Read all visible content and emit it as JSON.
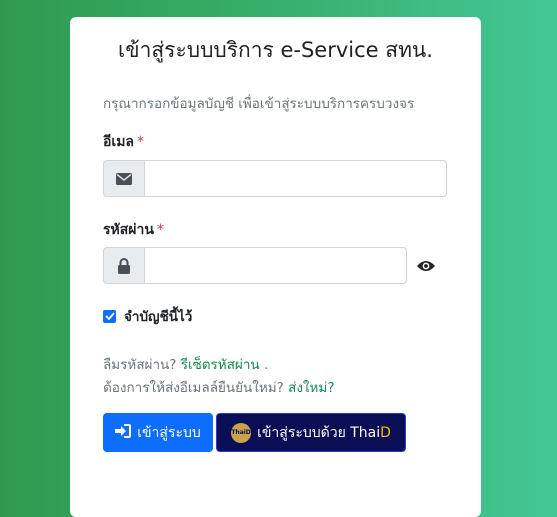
{
  "page": {
    "title": "เข้าสู่ระบบบริการ e-Service สทน.",
    "intro": "กรุณากรอกข้อมูลบัญชี เพื่อเข้าสู่ระบบบริการครบวงจร"
  },
  "form": {
    "email_label": "อีเมล",
    "required_mark": "*",
    "email_value": "",
    "email_icon": "envelope-icon",
    "password_label": "รหัสผ่าน",
    "password_value": "",
    "password_icon": "lock-icon",
    "show_password_icon": "eye-icon",
    "remember_label": "จำบัญชีนี้ไว้",
    "remember_checked": true
  },
  "links": {
    "forgot_prefix": "ลืมรหัสผ่าน?",
    "forgot_link": "รีเซ็ตรหัสผ่าน",
    "forgot_suffix": ".",
    "resend_prefix": "ต้องการให้ส่งอีเมลล์ยืนยันใหม่?",
    "resend_link": "ส่งใหม่?"
  },
  "buttons": {
    "login_label": "เข้าสู่ระบบ",
    "login_icon": "sign-in-icon",
    "thaid_label_prefix": "เข้าสู่ระบบด้วย Thai",
    "thaid_label_suffix": "D",
    "thaid_logo_text": "ThaiD"
  },
  "colors": {
    "primary": "#0d6efd",
    "thaid_bg": "#0a0e55",
    "link": "#198754",
    "required": "#dc3545"
  }
}
